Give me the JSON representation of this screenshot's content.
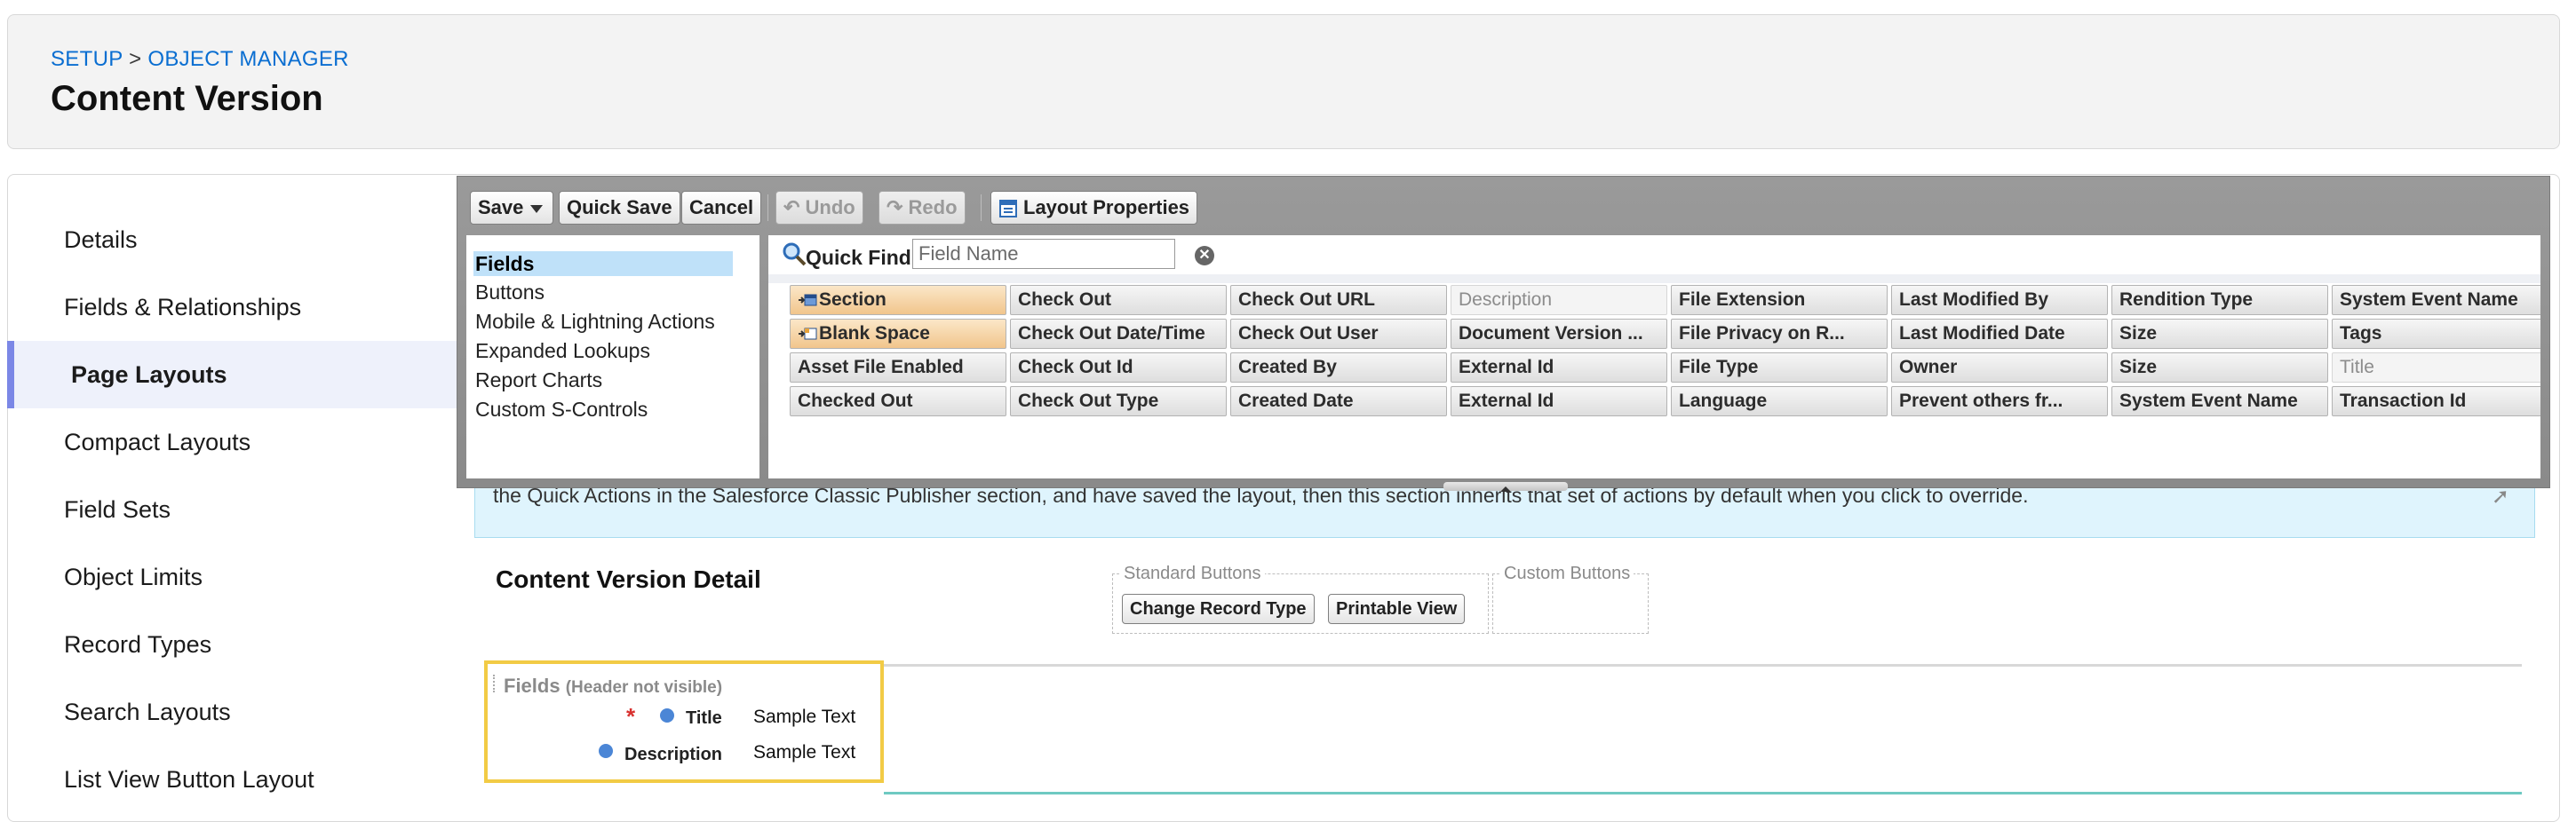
{
  "breadcrumb": {
    "setup": "SETUP",
    "separator": ">",
    "object_manager": "OBJECT MANAGER"
  },
  "page_title": "Content Version",
  "sidebar": {
    "items": [
      {
        "label": "Details",
        "active": false
      },
      {
        "label": "Fields & Relationships",
        "active": false
      },
      {
        "label": "Page Layouts",
        "active": true
      },
      {
        "label": "Compact Layouts",
        "active": false
      },
      {
        "label": "Field Sets",
        "active": false
      },
      {
        "label": "Object Limits",
        "active": false
      },
      {
        "label": "Record Types",
        "active": false
      },
      {
        "label": "Search Layouts",
        "active": false
      },
      {
        "label": "List View Button Layout",
        "active": false
      }
    ]
  },
  "toolbar": {
    "save": "Save",
    "quick_save": "Quick Save",
    "cancel": "Cancel",
    "undo": "Undo",
    "redo": "Redo",
    "layout_properties": "Layout Properties"
  },
  "palette": {
    "categories": [
      "Fields",
      "Buttons",
      "Mobile & Lightning Actions",
      "Expanded Lookups",
      "Report Charts",
      "Custom S-Controls"
    ],
    "selected_category": "Fields",
    "quick_find_label": "Quick Find",
    "quick_find_placeholder": "Field Name",
    "fields": [
      [
        "Section",
        "Blank Space",
        "Asset File Enabled",
        "Checked Out"
      ],
      [
        "Check Out",
        "Check Out Date/Time",
        "Check Out Id",
        "Check Out Type"
      ],
      [
        "Check Out URL",
        "Check Out User",
        "Created By",
        "Created Date"
      ],
      [
        "Description",
        "Document Version ...",
        "External Id",
        "External Id"
      ],
      [
        "File Extension",
        "File Privacy on R...",
        "File Type",
        "Language"
      ],
      [
        "Last Modified By",
        "Last Modified Date",
        "Owner",
        "Prevent others fr..."
      ],
      [
        "Rendition Type",
        "Size",
        "Size",
        "System Event Name"
      ],
      [
        "System Event Name",
        "Tags",
        "Title",
        "Transaction Id"
      ]
    ]
  },
  "info_text": "the Quick Actions in the Salesforce Classic Publisher section, and have saved the layout, then this section inherits that set of actions by default when you click to override.",
  "detail": {
    "title": "Content Version Detail",
    "standard_buttons_label": "Standard Buttons",
    "custom_buttons_label": "Custom Buttons",
    "standard_buttons": [
      "Change Record Type",
      "Printable View"
    ]
  },
  "fields_section": {
    "title": "Fields",
    "subtitle": "(Header not visible)",
    "rows": [
      {
        "label": "Title",
        "value": "Sample Text",
        "required": true
      },
      {
        "label": "Description",
        "value": "Sample Text",
        "required": false
      }
    ]
  },
  "colors": {
    "link": "#0a6ed1",
    "active_bar": "#7b87e6",
    "highlight": "#f2cb45",
    "info_bg": "#dff4fd"
  }
}
